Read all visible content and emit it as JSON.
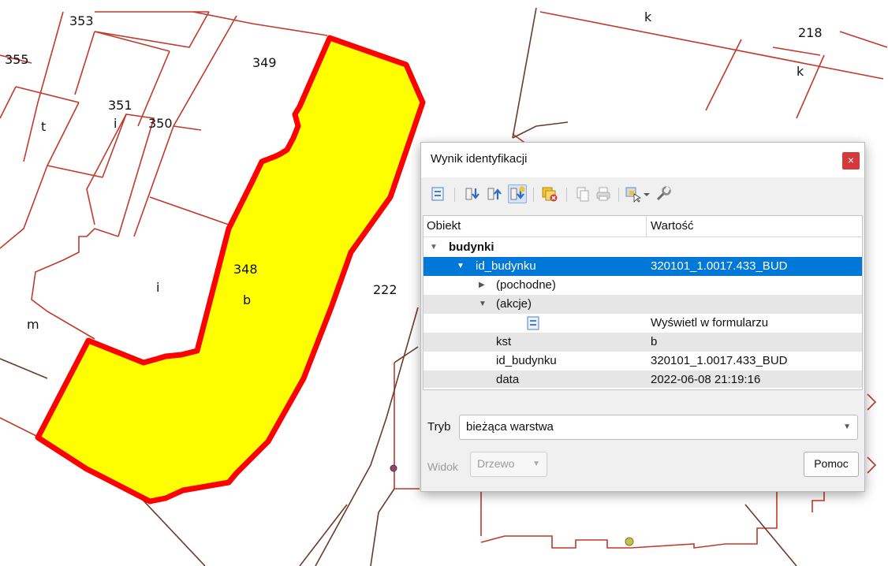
{
  "map": {
    "labels": {
      "p353": "353",
      "p355": "355",
      "p349": "349",
      "p351": "351",
      "i1": "i",
      "t": "t",
      "p350": "350",
      "k1": "k",
      "p218": "218",
      "k2": "k",
      "p348": "348",
      "b": "b",
      "i2": "i",
      "m": "m",
      "p222": "222"
    },
    "colors": {
      "parcel_line": "#c0392b",
      "building_line": "#6b3a2a",
      "selection_fill": "#ffff00",
      "selection_border": "#ff0000"
    }
  },
  "dialog": {
    "title": "Wynik identyfikacji",
    "close_label": "×",
    "toolbar_icons": [
      "expand-icon",
      "expand-tree-icon",
      "collapse-tree-icon",
      "expand-new-results-icon",
      "clear-results-icon",
      "copy-icon",
      "print-icon",
      "select-features-icon",
      "identify-settings-icon"
    ],
    "columns": {
      "feature": "Obiekt",
      "value": "Wartość"
    },
    "tree": {
      "layer": "budynki",
      "selected": {
        "name": "id_budynku",
        "value": "320101_1.0017.433_BUD"
      },
      "derived": "(pochodne)",
      "actions": "(akcje)",
      "action_form": "Wyświetl w formularzu",
      "attributes": [
        {
          "name": "kst",
          "value": "b"
        },
        {
          "name": "id_budynku",
          "value": "320101_1.0017.433_BUD"
        },
        {
          "name": "data",
          "value": "2022-06-08 21:19:16"
        }
      ]
    },
    "mode_label": "Tryb",
    "mode_value": "bieżąca warstwa",
    "view_label": "Widok",
    "view_value": "Drzewo",
    "help_button": "Pomoc"
  }
}
